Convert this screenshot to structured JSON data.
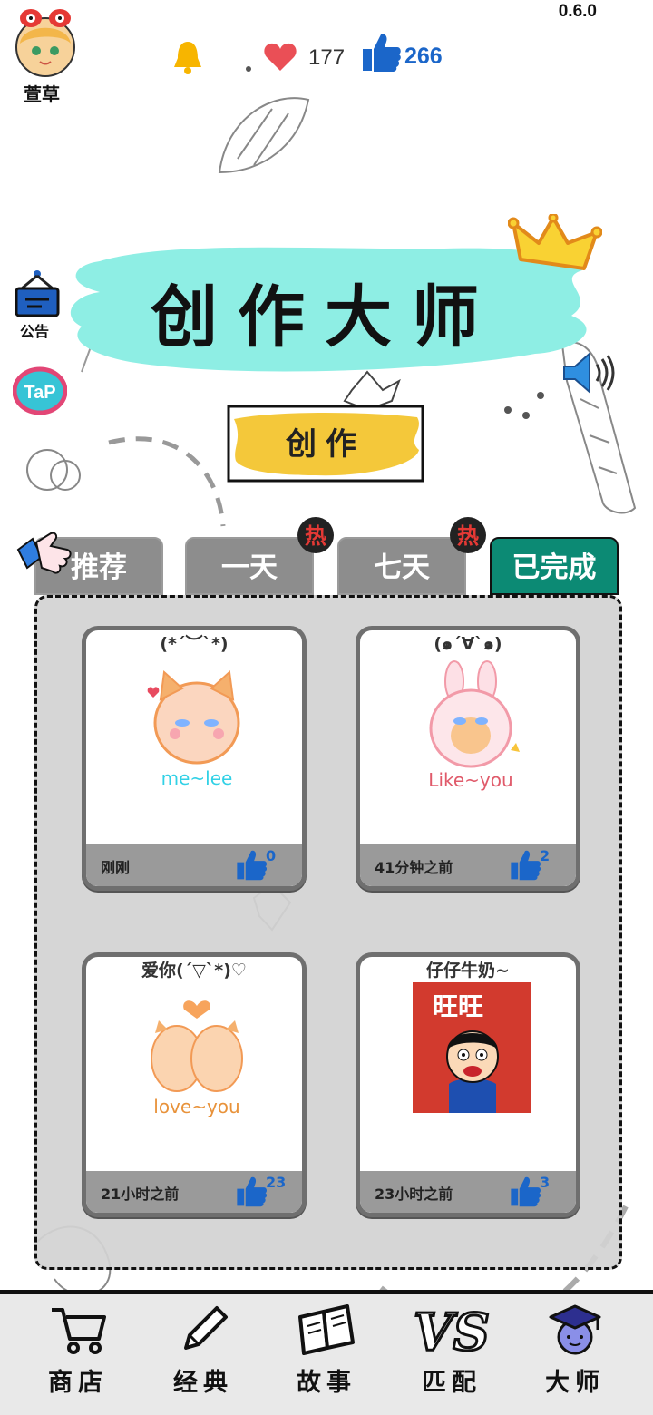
{
  "app": {
    "version": "0.6.0",
    "user": {
      "name": "萱草"
    },
    "stats": {
      "hearts": "177",
      "likes": "266"
    }
  },
  "colors": {
    "accent": "#0c8a74",
    "likes_blue": "#1b66c9",
    "tab_gray": "#8d8d8d",
    "banner_cyan": "#8eeee4",
    "button_yellow": "#f4c83a"
  },
  "banner": {
    "title": "创作大师"
  },
  "side_icons": {
    "notice_label": "公告",
    "tap_icon": "tap-logo-icon",
    "speaker_icon": "speaker-icon"
  },
  "create_button": {
    "label": "创作"
  },
  "tabs": [
    {
      "label": "推荐",
      "hot": false,
      "active": false
    },
    {
      "label": "一天",
      "hot": true,
      "active": false
    },
    {
      "label": "七天",
      "hot": true,
      "active": false
    },
    {
      "label": "已完成",
      "hot": false,
      "active": true
    }
  ],
  "hot_badge_text": "热",
  "cards": [
    {
      "title": "(*´︶`*)",
      "time": "刚刚",
      "likes": "0",
      "image_caption": "me~lee"
    },
    {
      "title": "(๑´∀`๑)",
      "time": "41分钟之前",
      "likes": "2",
      "image_caption": "Like~you"
    },
    {
      "title": "爱你(´▽`*)♡",
      "time": "21小时之前",
      "likes": "23",
      "image_caption": "love~you"
    },
    {
      "title": "仔仔牛奶~",
      "time": "23小时之前",
      "likes": "3",
      "image_caption": "旺旺"
    }
  ],
  "nav": [
    {
      "label": "商店",
      "icon": "cart-icon"
    },
    {
      "label": "经典",
      "icon": "pencil-icon"
    },
    {
      "label": "故事",
      "icon": "book-icon"
    },
    {
      "label": "匹配",
      "icon": "vs-icon"
    },
    {
      "label": "大师",
      "icon": "graduate-icon"
    }
  ]
}
